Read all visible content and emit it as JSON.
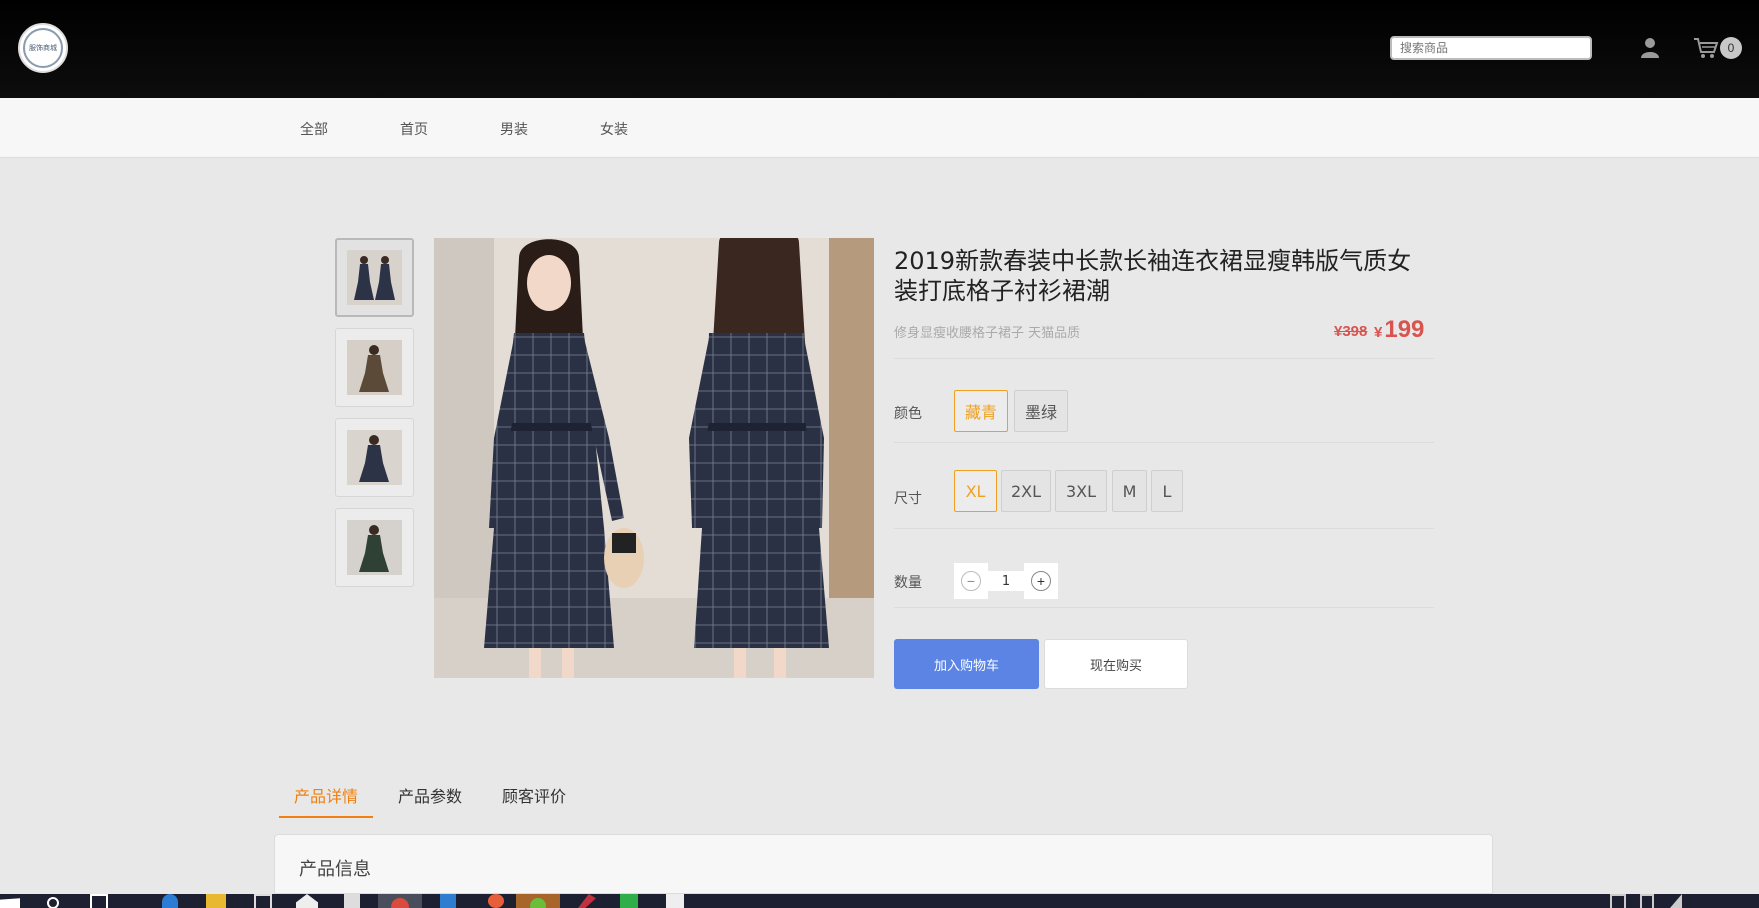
{
  "header": {
    "logo_text": "服饰商城",
    "search_placeholder": "搜索商品",
    "cart_count": "0"
  },
  "nav": {
    "items": [
      "全部",
      "首页",
      "男装",
      "女装"
    ]
  },
  "product": {
    "title": "2019新款春装中长款长袖连衣裙显瘦韩版气质女装打底格子衬衫裙潮",
    "subtitle": "修身显瘦收腰格子裙子 天猫品质",
    "old_price": "¥398",
    "currency": "¥",
    "price": "199",
    "color_label": "颜色",
    "colors": [
      "藏青",
      "墨绿"
    ],
    "selected_color": "藏青",
    "size_label": "尺寸",
    "sizes": [
      "XL",
      "2XL",
      "3XL",
      "M",
      "L"
    ],
    "selected_size": "XL",
    "quantity_label": "数量",
    "quantity": "1",
    "minus_symbol": "−",
    "plus_symbol": "+",
    "add_to_cart_label": "加入购物车",
    "buy_now_label": "现在购买"
  },
  "tabs": {
    "items": [
      "产品详情",
      "产品参数",
      "顾客评价"
    ],
    "active": "产品详情"
  },
  "panel": {
    "title": "产品信息"
  },
  "colors": {
    "accent": "#f08010",
    "price": "#d9534f",
    "primary_button": "#5b84e4",
    "header": "#000000"
  }
}
